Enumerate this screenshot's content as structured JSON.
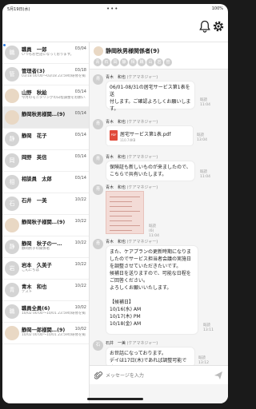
{
  "status": {
    "time": "5月19日(水)",
    "dots": "•••",
    "right": "100%"
  },
  "sidebar": {
    "items": [
      {
        "name": "職員　一郎",
        "date": "03/04",
        "sub": "いつもお世話になっております。",
        "initial": "職",
        "photo": false,
        "unread": true
      },
      {
        "name": "管理者(3)",
        "date": "03/18",
        "sub": "03/18 00:00～03/18 23:59の研修を掲載し…",
        "initial": "管",
        "photo": false,
        "unread": false
      },
      {
        "name": "山野　秋絵",
        "date": "03/14",
        "sub": "今月のモニタリングの日程調整をお願い…",
        "initial": "",
        "photo": true,
        "unread": false
      },
      {
        "name": "静岡秋男様関…(9)",
        "date": "03/14",
        "sub": "",
        "initial": "",
        "photo": true,
        "unread": false
      },
      {
        "name": "静岡　花子",
        "date": "03/14",
        "sub": "",
        "initial": "静",
        "photo": false,
        "unread": false
      },
      {
        "name": "岡野　英信",
        "date": "03/14",
        "sub": "",
        "initial": "岡",
        "photo": false,
        "unread": false
      },
      {
        "name": "相談員　太郎",
        "date": "03/14",
        "sub": "",
        "initial": "相",
        "photo": false,
        "unread": false
      },
      {
        "name": "石井　一美",
        "date": "10/22",
        "sub": "",
        "initial": "石",
        "photo": false,
        "unread": false
      },
      {
        "name": "静岡秋子様関…(9)",
        "date": "10/22",
        "sub": "",
        "initial": "",
        "photo": true,
        "unread": false
      },
      {
        "name": "静岡　秋子の一…",
        "date": "10/22",
        "sub": "静岡秋子の関係者",
        "initial": "静",
        "photo": false,
        "unread": false
      },
      {
        "name": "岩本　久美子",
        "date": "10/22",
        "sub": "こんにちは",
        "initial": "岩",
        "photo": false,
        "unread": false
      },
      {
        "name": "青木　和也",
        "date": "10/22",
        "sub": "テスト",
        "initial": "青",
        "photo": false,
        "unread": false
      },
      {
        "name": "職員全員(6)",
        "date": "10/02",
        "sub": "10/02 00:00～10/01 23:59の研修を掲載し…",
        "initial": "職",
        "photo": false,
        "unread": false
      },
      {
        "name": "静岡一郎様関…(9)",
        "date": "10/02",
        "sub": "10/02 00:00～10/01 23:59の研修を掲載し…",
        "initial": "",
        "photo": true,
        "unread": false
      }
    ]
  },
  "room": {
    "title": "静岡秋男様関係者(9)",
    "members": [
      "青",
      "石",
      "岡",
      "静",
      "相",
      "職",
      "山",
      "岩",
      "管"
    ]
  },
  "messages": [
    {
      "sender": "青木　和也",
      "role": "(ケアマネジャー)",
      "text": "06/01-08/31の居宅サービス第1表を送\n付します。ご確認よろしくお願いしま\nす。",
      "meta": "既読\n11:04"
    },
    {
      "sender": "青木　和也",
      "role": "(ケアマネジャー)",
      "file_name": "居宅サービス第1表.pdf",
      "file_size": "110.74KB",
      "meta": "既読\n13:04"
    },
    {
      "sender": "青木　和也",
      "role": "(ケアマネジャー)",
      "text": "保険証も新しいものが来ましたので、\nこちらで共有いたします。",
      "meta": "既読\n11:04"
    },
    {
      "sender": "青木　和也",
      "role": "(ケアマネジャー)",
      "image": true,
      "meta": "既読(6)\n11:04"
    },
    {
      "sender": "青木　和也",
      "role": "(ケアマネジャー)",
      "text": "また、ケアプランの更新時期になりま\nしたのでサービス担当者会議の実施日\nを調整させていただきたいです。\n候補日を送りますので、可能な日程を\nご回答ください。\nよろしくお願いいたします。\n\n【候補日】\n10/16(水) AM\n10/17(木) PM\n10/18(金) AM",
      "meta": "既読\n13:11"
    },
    {
      "sender": "石井　一美",
      "role": "(ケアマネジャー)",
      "text": "お世話になっております。\nデイは17日(木)であれば調整可能です。",
      "meta": "既読\n13:12"
    }
  ],
  "input": {
    "placeholder": "メッセージを入力"
  }
}
